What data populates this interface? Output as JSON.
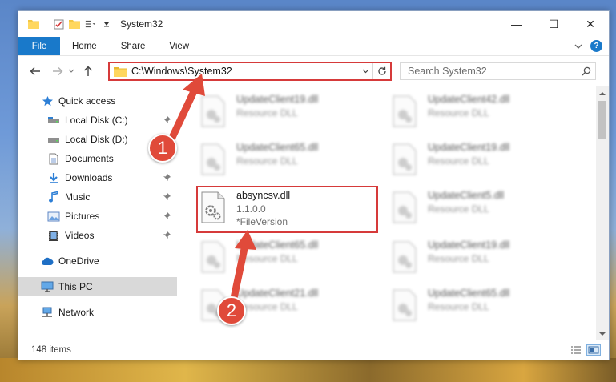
{
  "window": {
    "title": "System32",
    "controls": {
      "minimize": "—",
      "maximize": "☐",
      "close": "✕"
    }
  },
  "ribbon": {
    "file_tab": "File",
    "tabs": [
      "Home",
      "Share",
      "View"
    ]
  },
  "address": {
    "path": "C:\\Windows\\System32"
  },
  "search": {
    "placeholder": "Search System32"
  },
  "sidebar": {
    "items": [
      {
        "label": "Quick access",
        "icon": "star-icon",
        "pinned": false
      },
      {
        "label": "Local Disk (C:)",
        "icon": "drive-icon",
        "pinned": true
      },
      {
        "label": "Local Disk (D:)",
        "icon": "drive-icon",
        "pinned": false
      },
      {
        "label": "Documents",
        "icon": "documents-icon",
        "pinned": false
      },
      {
        "label": "Downloads",
        "icon": "download-icon",
        "pinned": true
      },
      {
        "label": "Music",
        "icon": "music-icon",
        "pinned": true
      },
      {
        "label": "Pictures",
        "icon": "pictures-icon",
        "pinned": true
      },
      {
        "label": "Videos",
        "icon": "videos-icon",
        "pinned": true
      },
      {
        "label": "OneDrive",
        "icon": "cloud-icon"
      },
      {
        "label": "This PC",
        "icon": "computer-icon"
      },
      {
        "label": "Network",
        "icon": "network-icon"
      }
    ]
  },
  "files": {
    "left_column": [
      {
        "name": "UpdateClient19.dll",
        "type": "Resource DLL"
      },
      {
        "name": "UpdateClient65.dll",
        "type": "Resource DLL"
      },
      {
        "name": "absyncsv.dll",
        "version": "1.1.0.0",
        "type": "*FileVersion"
      },
      {
        "name": "UpdateClient65.dll",
        "type": "Resource DLL"
      },
      {
        "name": "UpdateClient21.dll",
        "type": "Resource DLL"
      }
    ],
    "right_column": [
      {
        "name": "UpdateClient42.dll",
        "type": "Resource DLL"
      },
      {
        "name": "UpdateClient19.dll",
        "type": "Resource DLL"
      },
      {
        "name": "UpdateClient5.dll",
        "type": "Resource DLL"
      },
      {
        "name": "UpdateClient19.dll",
        "type": "Resource DLL"
      },
      {
        "name": "UpdateClient65.dll",
        "type": "Resource DLL"
      }
    ]
  },
  "status": {
    "item_count": "148 items"
  },
  "annotations": {
    "step1": "1",
    "step2": "2",
    "color": "#e04a3a"
  }
}
